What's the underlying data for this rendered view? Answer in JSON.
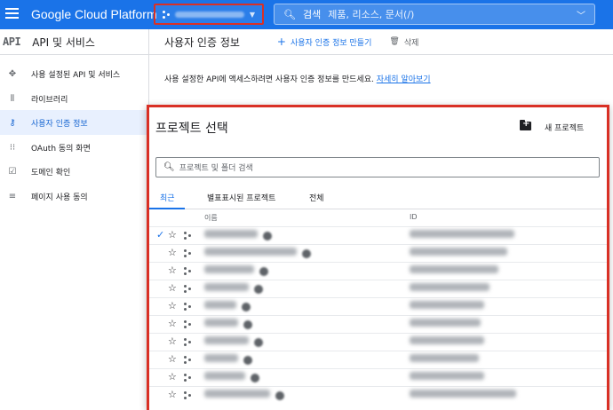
{
  "topbar": {
    "brand": "Google Cloud Platform",
    "project_name": "",
    "search_label": "검색",
    "search_placeholder": "제품, 리소스, 문서(/)"
  },
  "api_header": {
    "logo": "API",
    "title": "API 및 서비스"
  },
  "main_header": {
    "page_title": "사용자 인증 정보",
    "create_label": "사용자 인증 정보 만들기",
    "delete_label": "삭제"
  },
  "sidebar": {
    "items": [
      {
        "label": "사용 설정된 API 및 서비스",
        "icon": "enabled-apis-icon",
        "active": false
      },
      {
        "label": "라이브러리",
        "icon": "library-icon",
        "active": false
      },
      {
        "label": "사용자 인증 정보",
        "icon": "key-icon",
        "active": true
      },
      {
        "label": "OAuth 동의 화면",
        "icon": "oauth-consent-icon",
        "active": false
      },
      {
        "label": "도메인 확인",
        "icon": "domain-verification-icon",
        "active": false
      },
      {
        "label": "페이지 사용 동의",
        "icon": "page-usage-icon",
        "active": false
      }
    ]
  },
  "main": {
    "description": "사용 설정한 API에 액세스하려면 사용자 인증 정보를 만드세요.",
    "learn_more": "자세히 알아보기"
  },
  "dialog": {
    "title": "프로젝트 선택",
    "new_project_label": "새 프로젝트",
    "search_placeholder": "프로젝트 및 폴더 검색",
    "tabs": [
      "최근",
      "별표표시된 프로젝트",
      "전체"
    ],
    "active_tab": 0,
    "columns": {
      "name": "이름",
      "id": "ID"
    },
    "rows": [
      {
        "name": "",
        "id": "",
        "selected": true
      },
      {
        "name": "",
        "id": "",
        "selected": false
      },
      {
        "name": "",
        "id": "",
        "selected": false
      },
      {
        "name": "",
        "id": "",
        "selected": false
      },
      {
        "name": "",
        "id": "",
        "selected": false
      },
      {
        "name": "",
        "id": "",
        "selected": false
      },
      {
        "name": "",
        "id": "",
        "selected": false
      },
      {
        "name": "",
        "id": "",
        "selected": false
      },
      {
        "name": "",
        "id": "",
        "selected": false
      },
      {
        "name": "",
        "id": "",
        "selected": false
      }
    ]
  },
  "colors": {
    "brand_blue": "#1a73e8",
    "highlight_red": "#d93025",
    "active_nav_bg": "#e8f0fe"
  }
}
